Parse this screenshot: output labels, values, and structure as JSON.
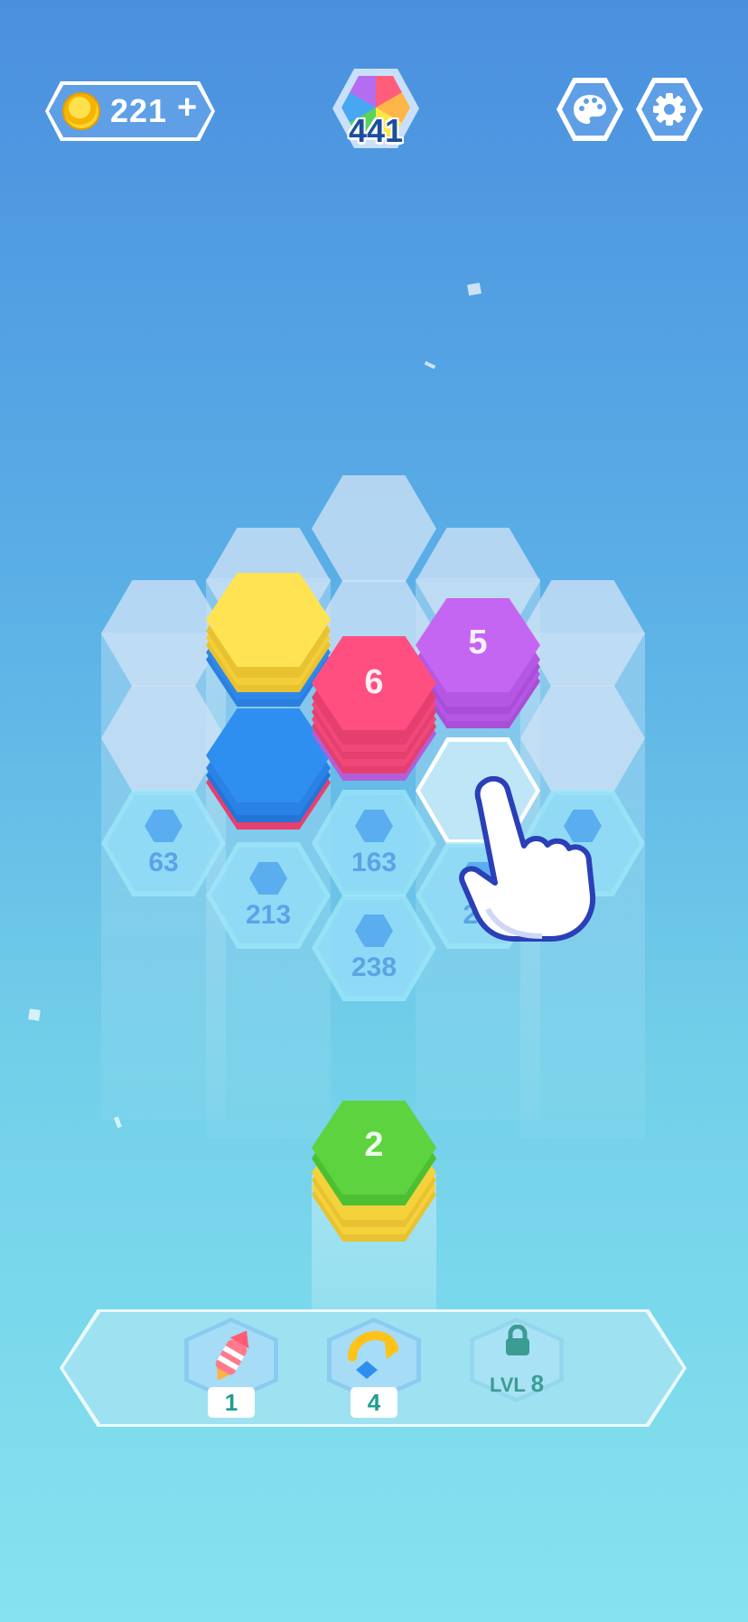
{
  "header": {
    "coins": "221",
    "add_coins_label": "+",
    "level_number": "441"
  },
  "board": {
    "locked_cells": [
      {
        "unlock_cost": "63"
      },
      {
        "unlock_cost": "213"
      },
      {
        "unlock_cost": "163"
      },
      {
        "unlock_cost": "238"
      },
      {
        "unlock_cost": "21"
      }
    ],
    "stacks": [
      {
        "color": "yellow",
        "count": ""
      },
      {
        "color": "pink",
        "count": "6"
      },
      {
        "color": "purple",
        "count": "5"
      },
      {
        "color": "blue",
        "count": ""
      }
    ]
  },
  "next_stack": {
    "color": "green",
    "count": "2"
  },
  "boosters": [
    {
      "icon": "rocket-icon",
      "count": "1"
    },
    {
      "icon": "swap-icon",
      "count": "4"
    },
    {
      "icon": "lock-icon",
      "label_prefix": "LVL",
      "label_level": "8"
    }
  ],
  "colors": {
    "yellow": "#ffe353",
    "pink": "#ff4f80",
    "purple": "#c566f2",
    "blue": "#2f8ff0",
    "green": "#5dd43f"
  }
}
